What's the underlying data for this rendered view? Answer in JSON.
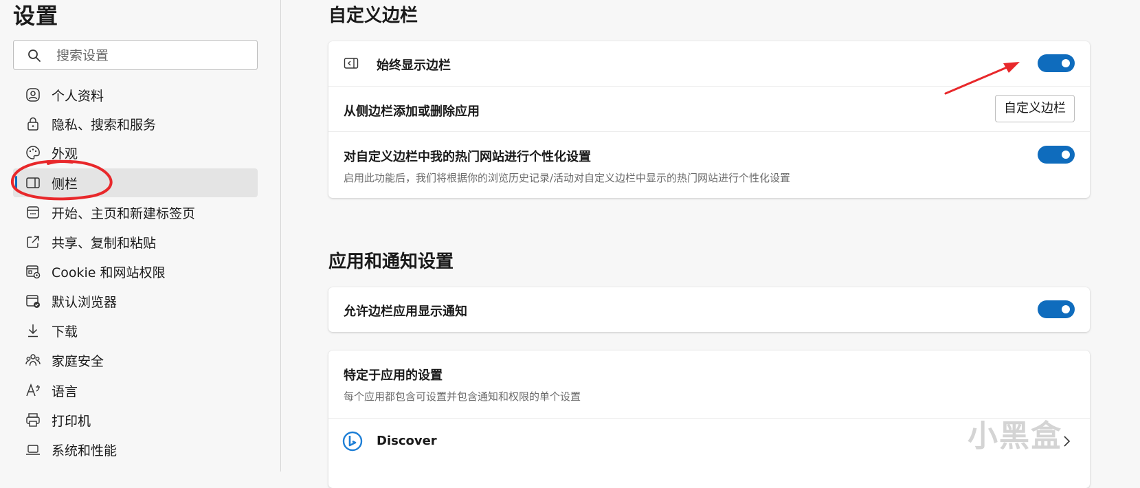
{
  "sidebar": {
    "title": "设置",
    "search_placeholder": "搜索设置",
    "items": [
      {
        "label": "个人资料",
        "icon": "profile-icon"
      },
      {
        "label": "隐私、搜索和服务",
        "icon": "lock-icon"
      },
      {
        "label": "外观",
        "icon": "palette-icon"
      },
      {
        "label": "侧栏",
        "icon": "sidebar-icon",
        "active": true
      },
      {
        "label": "开始、主页和新建标签页",
        "icon": "start-page-icon"
      },
      {
        "label": "共享、复制和粘贴",
        "icon": "share-icon"
      },
      {
        "label": "Cookie 和网站权限",
        "icon": "cookie-icon"
      },
      {
        "label": "默认浏览器",
        "icon": "default-browser-icon"
      },
      {
        "label": "下载",
        "icon": "download-icon"
      },
      {
        "label": "家庭安全",
        "icon": "family-icon"
      },
      {
        "label": "语言",
        "icon": "language-icon"
      },
      {
        "label": "打印机",
        "icon": "printer-icon"
      },
      {
        "label": "系统和性能",
        "icon": "laptop-icon"
      }
    ]
  },
  "customize_sidebar": {
    "title": "自定义边栏",
    "always_show": {
      "label": "始终显示边栏",
      "enabled": true
    },
    "add_remove": {
      "label": "从侧边栏添加或删除应用",
      "button": "自定义边栏"
    },
    "personalize": {
      "label": "对自定义边栏中我的热门网站进行个性化设置",
      "description": "启用此功能后，我们将根据你的浏览历史记录/活动对自定义边栏中显示的热门网站进行个性化设置",
      "enabled": true
    }
  },
  "apps_notifications": {
    "title": "应用和通知设置",
    "allow_notifications": {
      "label": "允许边栏应用显示通知",
      "enabled": true
    },
    "app_specific": {
      "label": "特定于应用的设置",
      "description": "每个应用都包含可设置并包含通知和权限的单个设置",
      "apps": [
        {
          "name": "Discover",
          "icon": "bing-discover-icon"
        }
      ]
    }
  },
  "watermark": "小黑盒",
  "colors": {
    "accent": "#0f6cbd",
    "annotation": "#e8282b"
  }
}
